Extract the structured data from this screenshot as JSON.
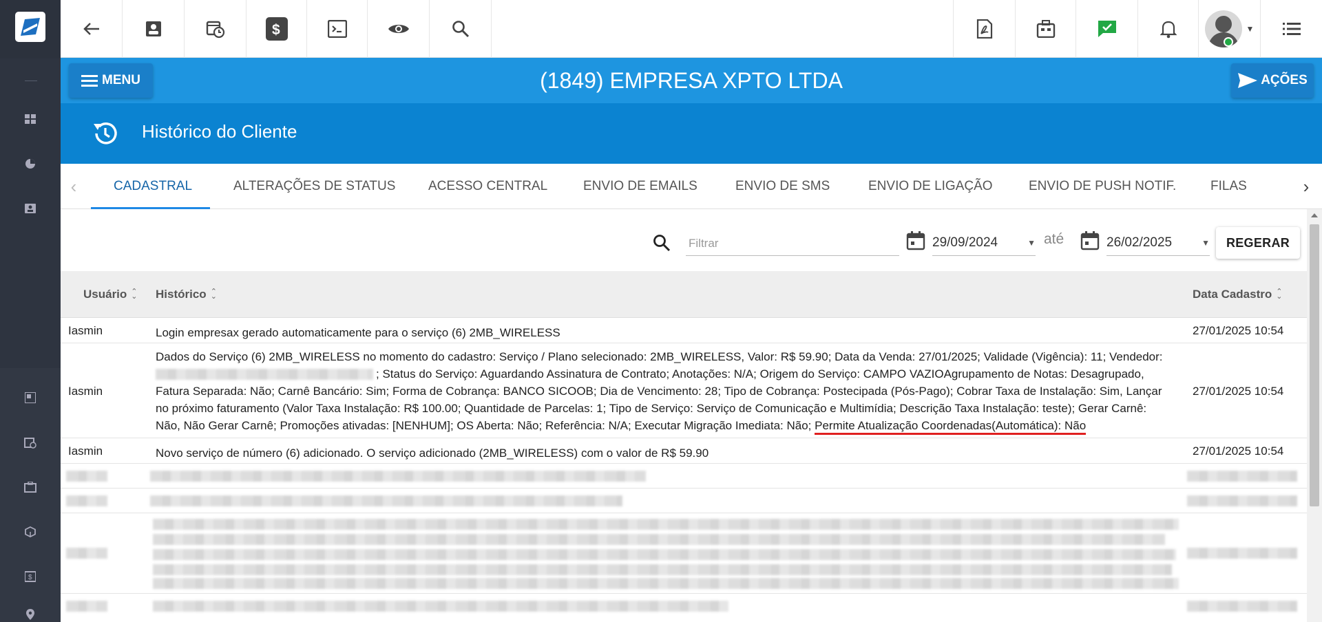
{
  "company": "(1849) EMPRESA XPTO LTDA",
  "menu_label": "MENU",
  "acoes_label": "AÇÕES",
  "section_title": "Histórico do Cliente",
  "tabs": [
    {
      "label": "CADASTRAL",
      "active": true
    },
    {
      "label": "ALTERAÇÕES DE STATUS",
      "active": false
    },
    {
      "label": "ACESSO CENTRAL",
      "active": false
    },
    {
      "label": "ENVIO DE EMAILS",
      "active": false
    },
    {
      "label": "ENVIO DE SMS",
      "active": false
    },
    {
      "label": "ENVIO DE LIGAÇÃO",
      "active": false
    },
    {
      "label": "ENVIO DE PUSH NOTIF.",
      "active": false
    },
    {
      "label": "FILAS",
      "active": false
    }
  ],
  "filter": {
    "placeholder": "Filtrar",
    "date_from": "29/09/2024",
    "date_sep": "até",
    "date_to": "26/02/2025",
    "regerar_label": "REGERAR"
  },
  "table": {
    "headers": {
      "user": "Usuário",
      "history": "Histórico",
      "date": "Data Cadastro"
    },
    "rows": [
      {
        "user": "Iasmin",
        "history": "Login empresax gerado automaticamente para o serviço (6) 2MB_WIRELESS",
        "date": "27/01/2025 10:54"
      },
      {
        "user": "Iasmin",
        "history_line1": "Dados do Serviço (6) 2MB_WIRELESS no momento do cadastro: Serviço / Plano selecionado: 2MB_WIRELESS, Valor: R$ 59.90; Data da Venda: 27/01/2025; Validade (Vigência): 11; Vendedor:",
        "history_line2": "; Status do Serviço: Aguardando Assinatura de Contrato; Anotações: N/A; Origem do Serviço: CAMPO VAZIOAgrupamento de Notas: Desagrupado,",
        "history_line3": "Fatura Separada: Não; Carnê Bancário: Sim; Forma de Cobrança: BANCO SICOOB; Dia de Vencimento: 28; Tipo de Cobrança: Postecipada (Pós-Pago); Cobrar Taxa de Instalação: Sim, Lançar",
        "history_line4": "no próximo faturamento (Valor Taxa Instalação: R$ 100.00; Quantidade de Parcelas: 1; Tipo de Serviço: Serviço de Comunicação e Multimídia; Descrição Taxa Instalação: teste); Gerar Carnê:",
        "history_line5": "Não, Não Gerar Carnê; Promoções ativadas: [NENHUM]; OS Aberta: Não; Referência: N/A; Executar Migração Imediata: Não;",
        "history_highlight": "Permite Atualização Coordenadas(Automática): Não",
        "date": "27/01/2025 10:54"
      },
      {
        "user": "Iasmin",
        "history": "Novo serviço de número (6) adicionado. O serviço adicionado (2MB_WIRELESS) com o valor de R$ 59.90",
        "date": "27/01/2025 10:54"
      }
    ]
  }
}
